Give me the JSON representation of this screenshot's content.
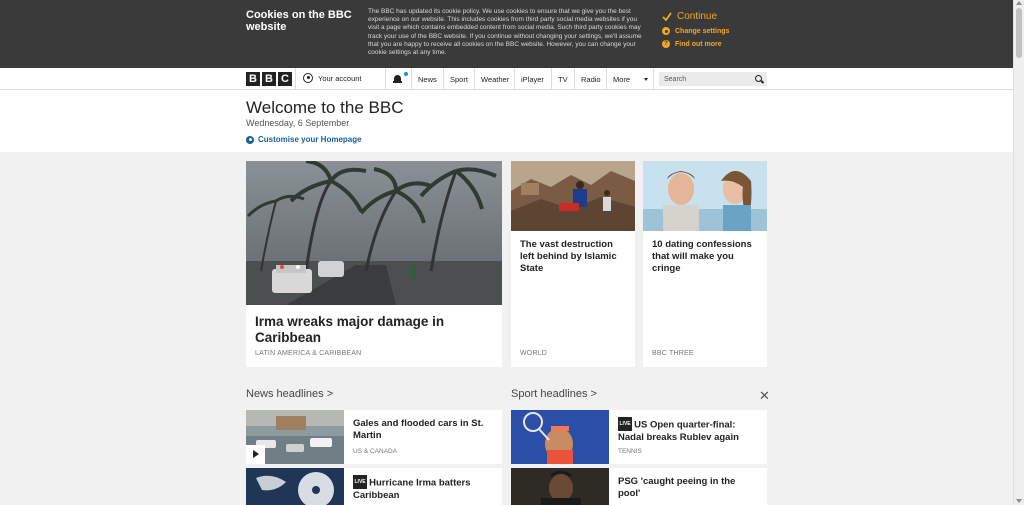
{
  "cookie": {
    "title": "Cookies on the BBC website",
    "text": "The BBC has updated its cookie policy. We use cookies to ensure that we give you the best experience on our website. This includes cookies from third party social media websites if you visit a page which contains embedded content from social media. Such third party cookies may track your use of the BBC website. If you continue without changing your settings, we'll assume that you are happy to receive all cookies on the BBC website. However, you can change your cookie settings at any time.",
    "continue_label": "Continue",
    "change_settings_label": "Change settings",
    "find_out_more_label": "Find out more"
  },
  "nav": {
    "logo": [
      "B",
      "B",
      "C"
    ],
    "account_label": "Your account",
    "items": [
      "News",
      "Sport",
      "Weather",
      "iPlayer",
      "TV",
      "Radio",
      "More"
    ],
    "search_placeholder": "Search"
  },
  "welcome": {
    "title": "Welcome to the BBC",
    "date": "Wednesday, 6 September",
    "customise_label": "Customise your Homepage"
  },
  "cards": [
    {
      "title": "Irma wreaks major damage in Caribbean",
      "tag": "LATIN AMERICA & CARIBBEAN"
    },
    {
      "title": "The vast destruction left behind by Islamic State",
      "tag": "WORLD"
    },
    {
      "title": "10 dating confessions that will make you cringe",
      "tag": "BBC THREE"
    }
  ],
  "sections": {
    "news_label": "News headlines >",
    "sport_label": "Sport headlines >",
    "close_label": "✕"
  },
  "news_headlines": [
    {
      "title": "Gales and flooded cars in St. Martin",
      "tag": "US & CANADA",
      "live": false
    },
    {
      "title": "Hurricane Irma batters Caribbean",
      "tag": "",
      "live": true
    }
  ],
  "sport_headlines": [
    {
      "title": "US Open quarter-final: Nadal breaks Rublev again",
      "tag": "TENNIS",
      "live": true
    },
    {
      "title": "PSG 'caught peeing in the pool'",
      "tag": "",
      "live": false
    }
  ],
  "live_badge": "LIVE",
  "colors": {
    "accent": "#f4a81c",
    "link": "#1a5e9a",
    "banner": "#3a3a3a"
  }
}
